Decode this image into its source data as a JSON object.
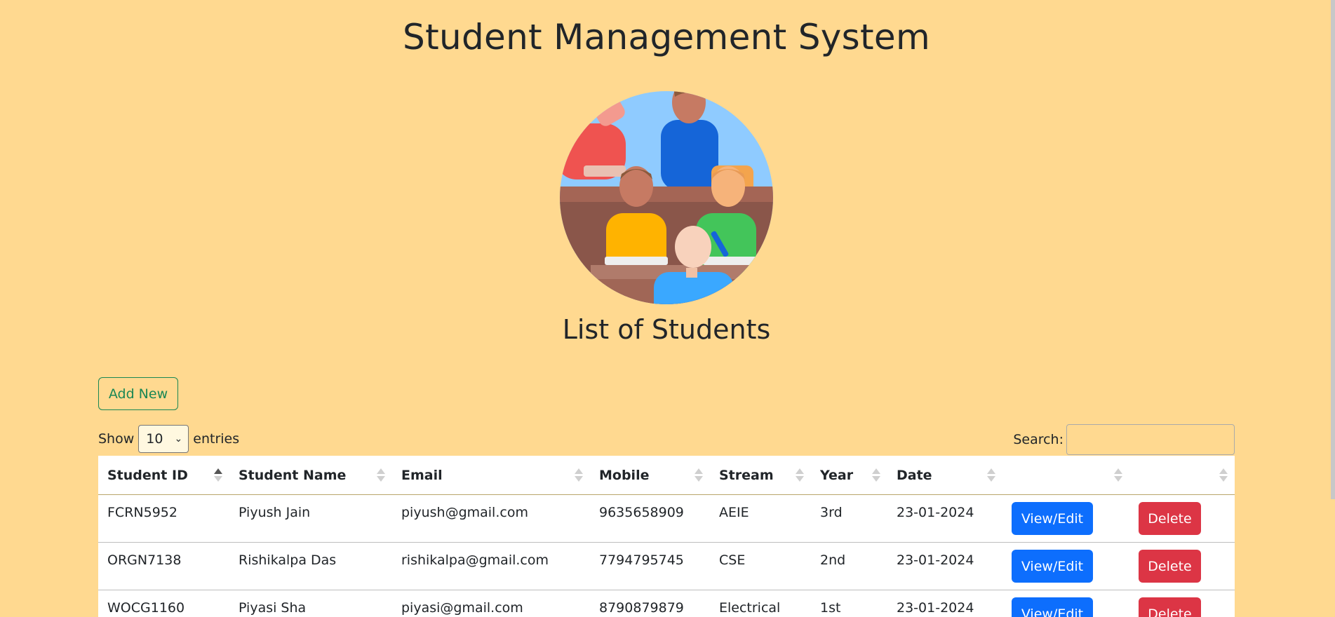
{
  "page": {
    "title": "Student Management System",
    "subtitle": "List of Students",
    "illustration": "students-classroom-illustration"
  },
  "controls": {
    "add_label": "Add New",
    "show_label": "Show",
    "entries_value": "10",
    "entries_label": "entries",
    "search_label": "Search:",
    "search_value": ""
  },
  "table": {
    "columns": [
      "Student ID",
      "Student Name",
      "Email",
      "Mobile",
      "Stream",
      "Year",
      "Date",
      "",
      ""
    ],
    "sorted_column": "Student ID",
    "sort_direction": "ascending",
    "view_label": "View/Edit",
    "delete_label": "Delete",
    "rows": [
      {
        "id": "FCRN5952",
        "name": "Piyush Jain",
        "email": "piyush@gmail.com",
        "mobile": "9635658909",
        "stream": "AEIE",
        "year": "3rd",
        "date": "23-01-2024"
      },
      {
        "id": "ORGN7138",
        "name": "Rishikalpa Das",
        "email": "rishikalpa@gmail.com",
        "mobile": "7794795745",
        "stream": "CSE",
        "year": "2nd",
        "date": "23-01-2024"
      },
      {
        "id": "WOCG1160",
        "name": "Piyasi Sha",
        "email": "piyasi@gmail.com",
        "mobile": "8790879879",
        "stream": "Electrical",
        "year": "1st",
        "date": "23-01-2024"
      }
    ]
  },
  "colors": {
    "background": "#ffd990",
    "primary": "#0d6efd",
    "danger": "#dc3545",
    "success": "#198754"
  }
}
